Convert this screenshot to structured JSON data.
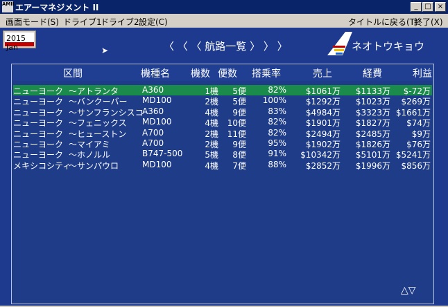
{
  "window": {
    "title": "エアーマネジメント II",
    "icon_text": "AMII"
  },
  "menu": [
    "画面モード(S)",
    "ドライブ1",
    "ドライブ2",
    "設定(C)",
    "タイトルに戻る(T)",
    "終了(X)"
  ],
  "date": {
    "text": "2015 Jan"
  },
  "screen": {
    "heading": "〈 〈 〈   航路一覧   〉 〉 〉",
    "company": "ネオトウキョウ"
  },
  "table": {
    "headers": [
      "区間",
      "機種名",
      "機数",
      "便数",
      "搭乗率",
      "売上",
      "経費",
      "利益"
    ],
    "rows": [
      {
        "from": "ニューヨーク",
        "to": "〜アトランタ",
        "model": "A360",
        "count": "1機",
        "flights": "5便",
        "load": "82%",
        "sales": "$1061万",
        "cost": "$1133万",
        "profit": "$-72万",
        "selected": true
      },
      {
        "from": "ニューヨーク",
        "to": "〜バンクーバー",
        "model": "MD100",
        "count": "2機",
        "flights": "5便",
        "load": "100%",
        "sales": "$1292万",
        "cost": "$1023万",
        "profit": "$269万",
        "selected": false
      },
      {
        "from": "ニューヨーク",
        "to": "〜サンフランシスコ",
        "model": "A360",
        "count": "4機",
        "flights": "9便",
        "load": "83%",
        "sales": "$4984万",
        "cost": "$3323万",
        "profit": "$1661万",
        "selected": false
      },
      {
        "from": "ニューヨーク",
        "to": "〜フェニックス",
        "model": "MD100",
        "count": "4機",
        "flights": "10便",
        "load": "82%",
        "sales": "$1901万",
        "cost": "$1827万",
        "profit": "$74万",
        "selected": false
      },
      {
        "from": "ニューヨーク",
        "to": "〜ヒューストン",
        "model": "A700",
        "count": "2機",
        "flights": "11便",
        "load": "82%",
        "sales": "$2494万",
        "cost": "$2485万",
        "profit": "$9万",
        "selected": false
      },
      {
        "from": "ニューヨーク",
        "to": "〜マイアミ",
        "model": "A700",
        "count": "2機",
        "flights": "9便",
        "load": "95%",
        "sales": "$1902万",
        "cost": "$1826万",
        "profit": "$76万",
        "selected": false
      },
      {
        "from": "ニューヨーク",
        "to": "〜ホノルル",
        "model": "B747-500",
        "count": "5機",
        "flights": "8便",
        "load": "91%",
        "sales": "$10342万",
        "cost": "$5101万",
        "profit": "$5241万",
        "selected": false
      },
      {
        "from": "メキシコシティ",
        "to": "〜サンパウロ",
        "model": "MD100",
        "count": "4機",
        "flights": "7便",
        "load": "88%",
        "sales": "$2852万",
        "cost": "$1996万",
        "profit": "$856万",
        "selected": false
      }
    ]
  },
  "pager": "△▽"
}
